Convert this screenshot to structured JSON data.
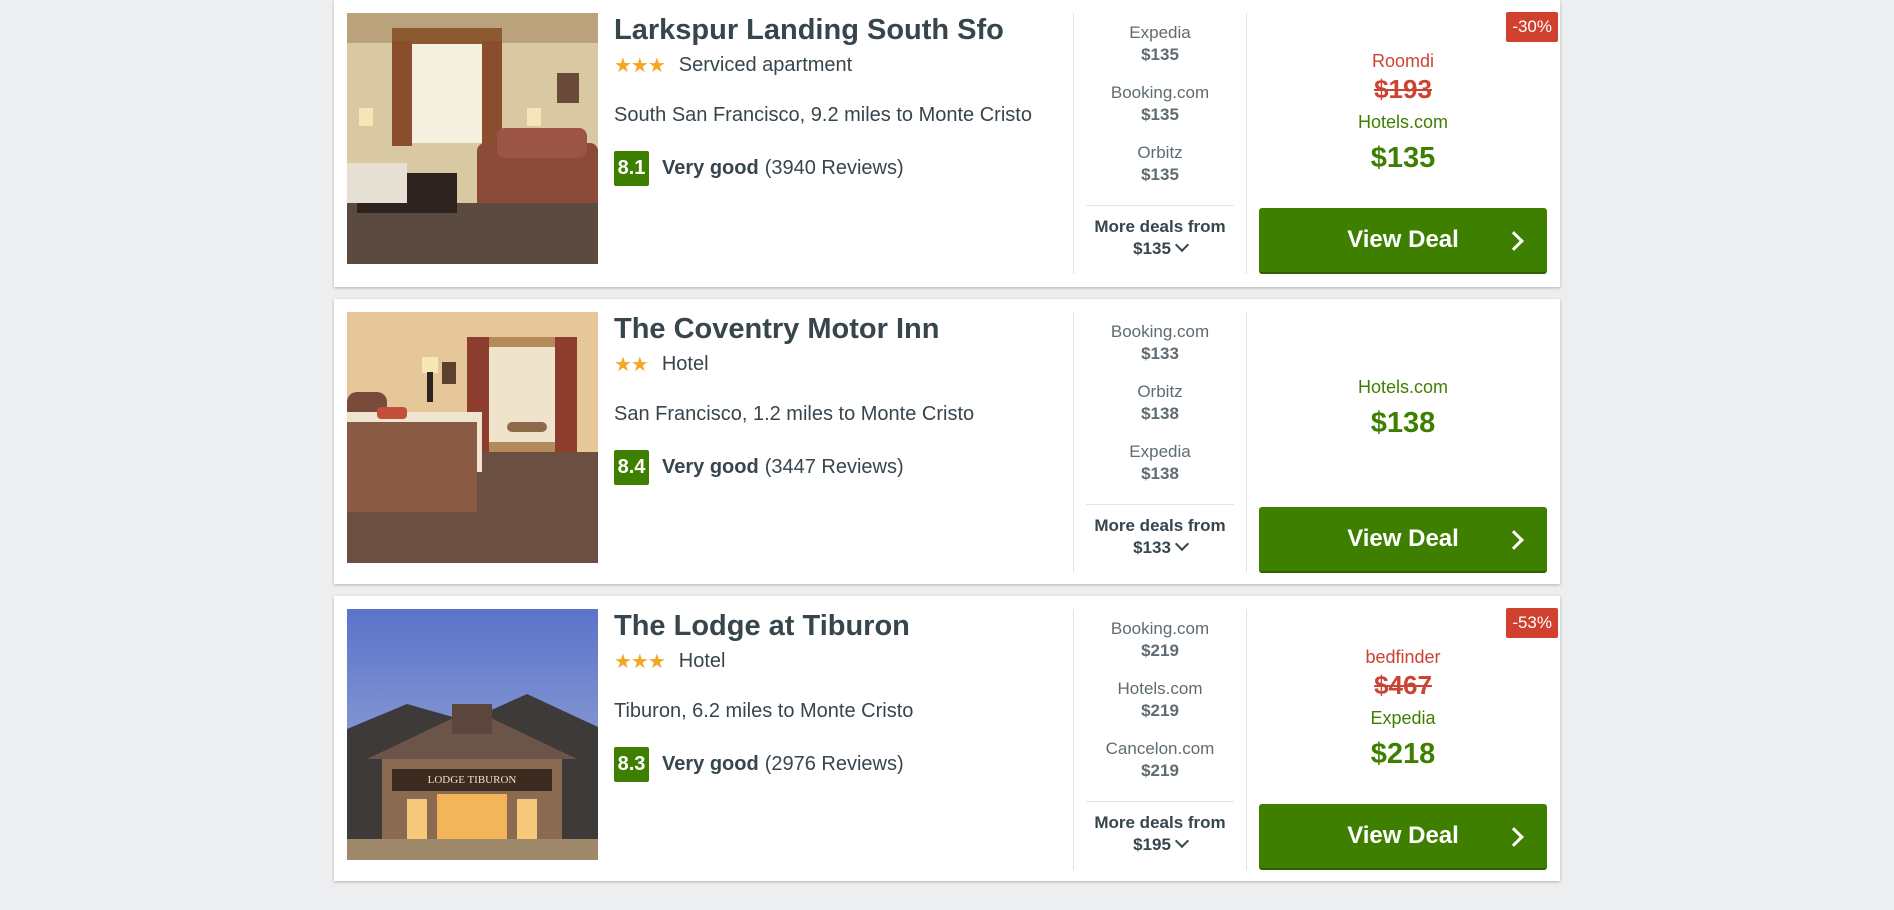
{
  "hotels": [
    {
      "name": "Larkspur Landing South Sfo",
      "stars": "★★★",
      "type": "Serviced apartment",
      "location": "South San Francisco, 9.2 miles to Monte Cristo",
      "score": "8.1",
      "rating_label": "Very good",
      "reviews": "(3940 Reviews)",
      "deals": [
        {
          "provider": "Expedia",
          "price": "$135"
        },
        {
          "provider": "Booking.com",
          "price": "$135"
        },
        {
          "provider": "Orbitz",
          "price": "$135"
        }
      ],
      "more_label": "More deals from",
      "more_price": "$135",
      "discount": "-30%",
      "old_provider": "Roomdi",
      "old_price": "$193",
      "current_provider": "Hotels.com",
      "current_price": "$135",
      "button_label": "View Deal",
      "photo": "living-room-photo"
    },
    {
      "name": "The Coventry Motor Inn",
      "stars": "★★",
      "type": "Hotel",
      "location": "San Francisco, 1.2 miles to Monte Cristo",
      "score": "8.4",
      "rating_label": "Very good",
      "reviews": "(3447 Reviews)",
      "deals": [
        {
          "provider": "Booking.com",
          "price": "$133"
        },
        {
          "provider": "Orbitz",
          "price": "$138"
        },
        {
          "provider": "Expedia",
          "price": "$138"
        }
      ],
      "more_label": "More deals from",
      "more_price": "$133",
      "discount": "",
      "old_provider": "",
      "old_price": "",
      "current_provider": "Hotels.com",
      "current_price": "$138",
      "button_label": "View Deal",
      "photo": "bedroom-photo"
    },
    {
      "name": "The Lodge at Tiburon",
      "stars": "★★★",
      "type": "Hotel",
      "location": "Tiburon, 6.2 miles to Monte Cristo",
      "score": "8.3",
      "rating_label": "Very good",
      "reviews": "(2976 Reviews)",
      "deals": [
        {
          "provider": "Booking.com",
          "price": "$219"
        },
        {
          "provider": "Hotels.com",
          "price": "$219"
        },
        {
          "provider": "Cancelon.com",
          "price": "$219"
        }
      ],
      "more_label": "More deals from",
      "more_price": "$195",
      "discount": "-53%",
      "old_provider": "bedfinder",
      "old_price": "$467",
      "current_provider": "Expedia",
      "current_price": "$218",
      "button_label": "View Deal",
      "photo": "lodge-exterior-photo",
      "photo_sign": "LODGE TIBURON"
    }
  ],
  "colors": {
    "accent_green": "#3f7f00",
    "discount_red": "#d0402e",
    "star_orange": "#f5a623"
  }
}
